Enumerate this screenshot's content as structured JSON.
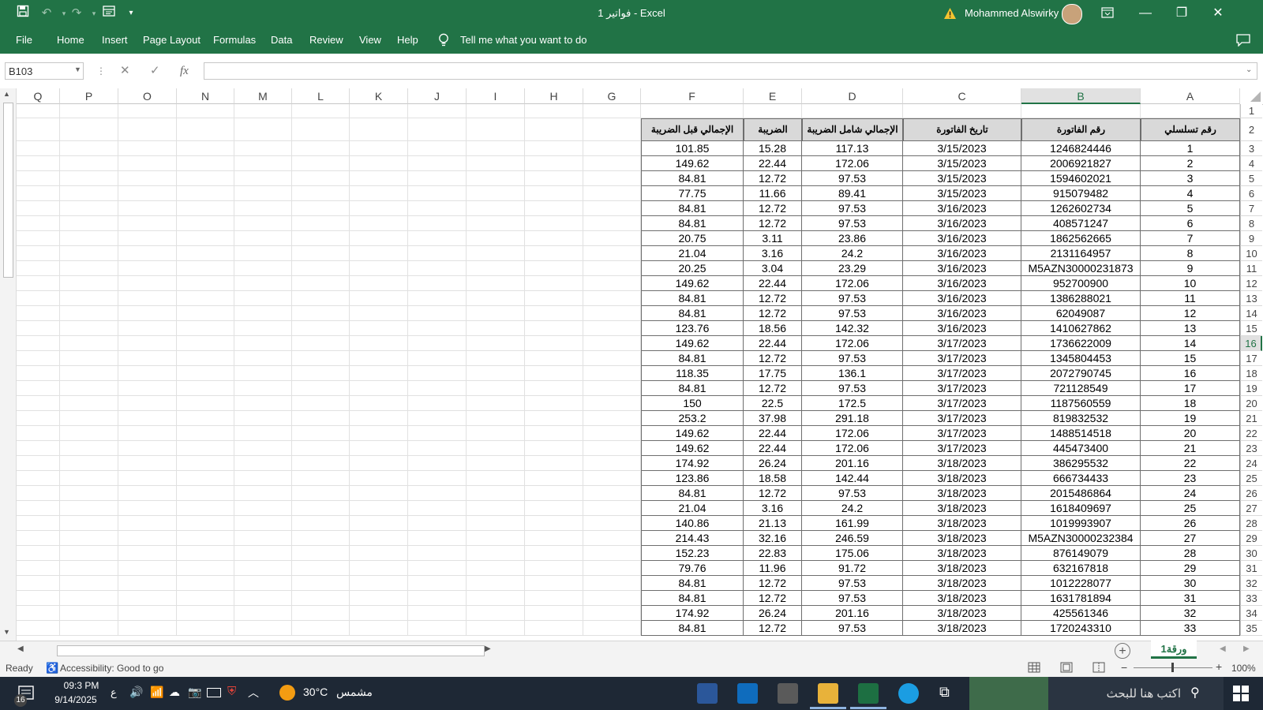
{
  "window": {
    "title": "فواتير 1  -  Excel",
    "user": "Mohammed Alswirky",
    "minimize": "—",
    "restore": "❐",
    "close": "✕"
  },
  "menu": [
    {
      "label": "File"
    },
    {
      "label": "Home"
    },
    {
      "label": "Insert"
    },
    {
      "label": "Page Layout"
    },
    {
      "label": "Formulas"
    },
    {
      "label": "Data"
    },
    {
      "label": "Review"
    },
    {
      "label": "View"
    },
    {
      "label": "Help"
    }
  ],
  "tell_me": "Tell me what you want to do",
  "name_box": "B103",
  "fx_label": "fx",
  "columns": [
    "Q",
    "P",
    "O",
    "N",
    "M",
    "L",
    "K",
    "J",
    "I",
    "H",
    "G",
    "F",
    "E",
    "D",
    "C",
    "B",
    "A"
  ],
  "selected_column": "B",
  "selected_row": "16",
  "table": {
    "headers": {
      "A": "رقم تسلسلي",
      "B": "رقم الفاتورة",
      "C": "تاريخ الفاتورة",
      "D": "الإجمالي شامل الضريبة",
      "E": "الضريبة",
      "F": "الإجمالي قبل الضريبة"
    },
    "rows": [
      {
        "r": "3",
        "a": "1",
        "b": "1246824446",
        "c": "3/15/2023",
        "d": "117.13",
        "e": "15.28",
        "f": "101.85"
      },
      {
        "r": "4",
        "a": "2",
        "b": "2006921827",
        "c": "3/15/2023",
        "d": "172.06",
        "e": "22.44",
        "f": "149.62"
      },
      {
        "r": "5",
        "a": "3",
        "b": "1594602021",
        "c": "3/15/2023",
        "d": "97.53",
        "e": "12.72",
        "f": "84.81"
      },
      {
        "r": "6",
        "a": "4",
        "b": "915079482",
        "c": "3/15/2023",
        "d": "89.41",
        "e": "11.66",
        "f": "77.75"
      },
      {
        "r": "7",
        "a": "5",
        "b": "1262602734",
        "c": "3/16/2023",
        "d": "97.53",
        "e": "12.72",
        "f": "84.81"
      },
      {
        "r": "8",
        "a": "6",
        "b": "408571247",
        "c": "3/16/2023",
        "d": "97.53",
        "e": "12.72",
        "f": "84.81"
      },
      {
        "r": "9",
        "a": "7",
        "b": "1862562665",
        "c": "3/16/2023",
        "d": "23.86",
        "e": "3.11",
        "f": "20.75"
      },
      {
        "r": "10",
        "a": "8",
        "b": "2131164957",
        "c": "3/16/2023",
        "d": "24.2",
        "e": "3.16",
        "f": "21.04"
      },
      {
        "r": "11",
        "a": "9",
        "b": "M5AZN30000231873",
        "c": "3/16/2023",
        "d": "23.29",
        "e": "3.04",
        "f": "20.25"
      },
      {
        "r": "12",
        "a": "10",
        "b": "952700900",
        "c": "3/16/2023",
        "d": "172.06",
        "e": "22.44",
        "f": "149.62"
      },
      {
        "r": "13",
        "a": "11",
        "b": "1386288021",
        "c": "3/16/2023",
        "d": "97.53",
        "e": "12.72",
        "f": "84.81"
      },
      {
        "r": "14",
        "a": "12",
        "b": "62049087",
        "c": "3/16/2023",
        "d": "97.53",
        "e": "12.72",
        "f": "84.81"
      },
      {
        "r": "15",
        "a": "13",
        "b": "1410627862",
        "c": "3/16/2023",
        "d": "142.32",
        "e": "18.56",
        "f": "123.76"
      },
      {
        "r": "16",
        "a": "14",
        "b": "1736622009",
        "c": "3/17/2023",
        "d": "172.06",
        "e": "22.44",
        "f": "149.62"
      },
      {
        "r": "17",
        "a": "15",
        "b": "1345804453",
        "c": "3/17/2023",
        "d": "97.53",
        "e": "12.72",
        "f": "84.81"
      },
      {
        "r": "18",
        "a": "16",
        "b": "2072790745",
        "c": "3/17/2023",
        "d": "136.1",
        "e": "17.75",
        "f": "118.35"
      },
      {
        "r": "19",
        "a": "17",
        "b": "721128549",
        "c": "3/17/2023",
        "d": "97.53",
        "e": "12.72",
        "f": "84.81"
      },
      {
        "r": "20",
        "a": "18",
        "b": "1187560559",
        "c": "3/17/2023",
        "d": "172.5",
        "e": "22.5",
        "f": "150"
      },
      {
        "r": "21",
        "a": "19",
        "b": "819832532",
        "c": "3/17/2023",
        "d": "291.18",
        "e": "37.98",
        "f": "253.2"
      },
      {
        "r": "22",
        "a": "20",
        "b": "1488514518",
        "c": "3/17/2023",
        "d": "172.06",
        "e": "22.44",
        "f": "149.62"
      },
      {
        "r": "23",
        "a": "21",
        "b": "445473400",
        "c": "3/17/2023",
        "d": "172.06",
        "e": "22.44",
        "f": "149.62"
      },
      {
        "r": "24",
        "a": "22",
        "b": "386295532",
        "c": "3/18/2023",
        "d": "201.16",
        "e": "26.24",
        "f": "174.92"
      },
      {
        "r": "25",
        "a": "23",
        "b": "666734433",
        "c": "3/18/2023",
        "d": "142.44",
        "e": "18.58",
        "f": "123.86"
      },
      {
        "r": "26",
        "a": "24",
        "b": "2015486864",
        "c": "3/18/2023",
        "d": "97.53",
        "e": "12.72",
        "f": "84.81"
      },
      {
        "r": "27",
        "a": "25",
        "b": "1618409697",
        "c": "3/18/2023",
        "d": "24.2",
        "e": "3.16",
        "f": "21.04"
      },
      {
        "r": "28",
        "a": "26",
        "b": "1019993907",
        "c": "3/18/2023",
        "d": "161.99",
        "e": "21.13",
        "f": "140.86"
      },
      {
        "r": "29",
        "a": "27",
        "b": "M5AZN30000232384",
        "c": "3/18/2023",
        "d": "246.59",
        "e": "32.16",
        "f": "214.43"
      },
      {
        "r": "30",
        "a": "28",
        "b": "876149079",
        "c": "3/18/2023",
        "d": "175.06",
        "e": "22.83",
        "f": "152.23"
      },
      {
        "r": "31",
        "a": "29",
        "b": "632167818",
        "c": "3/18/2023",
        "d": "91.72",
        "e": "11.96",
        "f": "79.76"
      },
      {
        "r": "32",
        "a": "30",
        "b": "1012228077",
        "c": "3/18/2023",
        "d": "97.53",
        "e": "12.72",
        "f": "84.81"
      },
      {
        "r": "33",
        "a": "31",
        "b": "1631781894",
        "c": "3/18/2023",
        "d": "97.53",
        "e": "12.72",
        "f": "84.81"
      },
      {
        "r": "34",
        "a": "32",
        "b": "425561346",
        "c": "3/18/2023",
        "d": "201.16",
        "e": "26.24",
        "f": "174.92"
      },
      {
        "r": "35",
        "a": "33",
        "b": "1720243310",
        "c": "3/18/2023",
        "d": "97.53",
        "e": "12.72",
        "f": "84.81"
      }
    ]
  },
  "sheet_tab": "ورقة1",
  "status": {
    "ready": "Ready",
    "accessibility": "Accessibility: Good to go",
    "zoom": "100%"
  },
  "taskbar": {
    "time": "09:3 PM",
    "date": "9/14/2025",
    "lang": "ع",
    "weather_temp": "30°C",
    "weather_text": "مشمس",
    "search_placeholder": "اكتب هنا للبحث",
    "notification_count": "16"
  },
  "colors": {
    "excel_green": "#217346",
    "taskbar": "#1e2835",
    "header_fill": "#d9d9d9"
  }
}
